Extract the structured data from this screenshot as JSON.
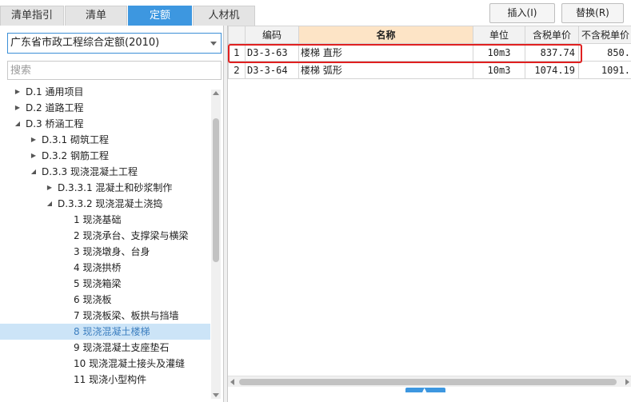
{
  "tabs": [
    {
      "label": "清单指引",
      "active": false
    },
    {
      "label": "清单",
      "active": false
    },
    {
      "label": "定额",
      "active": true
    },
    {
      "label": "人材机",
      "active": false
    }
  ],
  "actions": {
    "insert": "插入(I)",
    "replace": "替换(R)"
  },
  "quota_library": {
    "selected": "广东省市政工程综合定额(2010)"
  },
  "search": {
    "placeholder": "搜索",
    "value": ""
  },
  "tree": [
    {
      "label": "D.1 通用项目",
      "level": 0,
      "state": "collapsed"
    },
    {
      "label": "D.2 道路工程",
      "level": 0,
      "state": "collapsed"
    },
    {
      "label": "D.3 桥涵工程",
      "level": 0,
      "state": "expanded"
    },
    {
      "label": "D.3.1 砌筑工程",
      "level": 1,
      "state": "collapsed"
    },
    {
      "label": "D.3.2 钢筋工程",
      "level": 1,
      "state": "collapsed"
    },
    {
      "label": "D.3.3 现浇混凝土工程",
      "level": 1,
      "state": "expanded"
    },
    {
      "label": "D.3.3.1 混凝土和砂浆制作",
      "level": 2,
      "state": "collapsed"
    },
    {
      "label": "D.3.3.2 现浇混凝土浇捣",
      "level": 2,
      "state": "expanded"
    },
    {
      "label": "1 现浇基础",
      "level": 3,
      "state": "leaf"
    },
    {
      "label": "2 现浇承台、支撑梁与横梁",
      "level": 3,
      "state": "leaf"
    },
    {
      "label": "3 现浇墩身、台身",
      "level": 3,
      "state": "leaf"
    },
    {
      "label": "4 现浇拱桥",
      "level": 3,
      "state": "leaf"
    },
    {
      "label": "5 现浇箱梁",
      "level": 3,
      "state": "leaf"
    },
    {
      "label": "6 现浇板",
      "level": 3,
      "state": "leaf"
    },
    {
      "label": "7 现浇板梁、板拱与挡墙",
      "level": 3,
      "state": "leaf"
    },
    {
      "label": "8 现浇混凝土楼梯",
      "level": 3,
      "state": "leaf",
      "selected": true
    },
    {
      "label": "9 现浇混凝土支座垫石",
      "level": 3,
      "state": "leaf"
    },
    {
      "label": "10 现浇混凝土接头及灌缝",
      "level": 3,
      "state": "leaf"
    },
    {
      "label": "11 现浇小型构件",
      "level": 3,
      "state": "leaf"
    }
  ],
  "grid": {
    "columns": [
      "",
      "编码",
      "名称",
      "单位",
      "含税单价",
      "不含税单价"
    ],
    "rows": [
      {
        "no": "1",
        "code": "D3-3-63",
        "name": "楼梯 直形",
        "unit": "10m3",
        "price_tax": "837.74",
        "price_notax": "850."
      },
      {
        "no": "2",
        "code": "D3-3-64",
        "name": "楼梯 弧形",
        "unit": "10m3",
        "price_tax": "1074.19",
        "price_notax": "1091."
      }
    ]
  },
  "colors": {
    "accent": "#3d97e0",
    "highlight": "#e02020",
    "selected_row": "#cce4f7",
    "sorted_header": "#fde4c6"
  }
}
